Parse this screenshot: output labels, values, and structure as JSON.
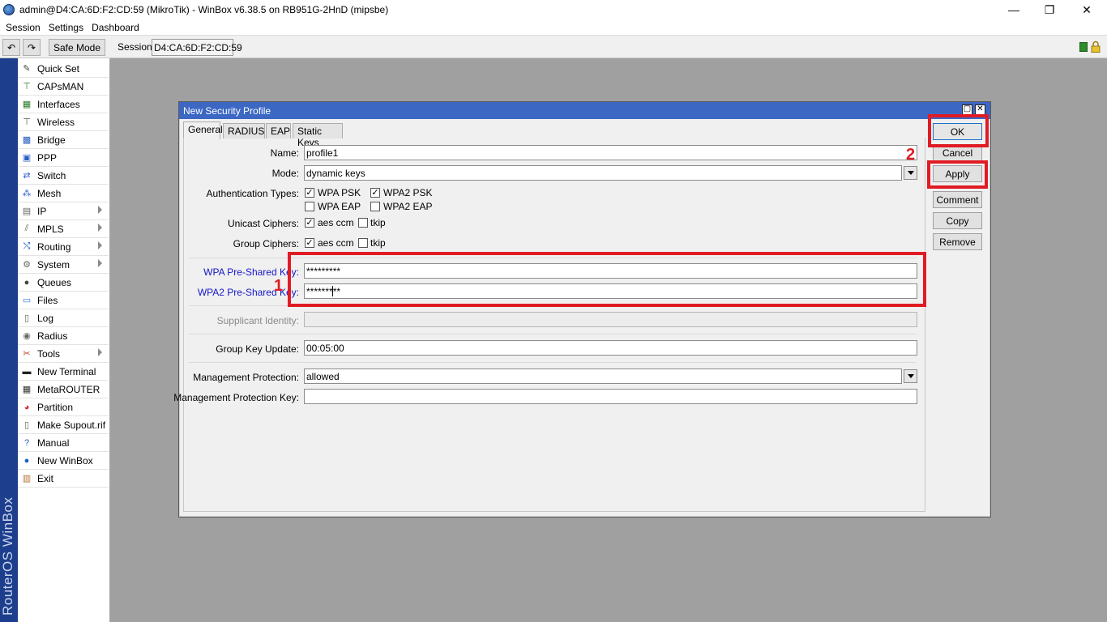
{
  "window": {
    "title": "admin@D4:CA:6D:F2:CD:59 (MikroTik) - WinBox v6.38.5 on RB951G-2HnD (mipsbe)",
    "minimize": "—",
    "restore": "❐",
    "close": "✕"
  },
  "menu": [
    "Session",
    "Settings",
    "Dashboard"
  ],
  "toolbar": {
    "undo_icon": "↶",
    "redo_icon": "↷",
    "safe_mode": "Safe Mode",
    "session_label": "Session:",
    "session_value": "D4:CA:6D:F2:CD:59"
  },
  "brand": "RouterOS WinBox",
  "sidebar": {
    "items": [
      {
        "label": "Quick Set",
        "icon": "quick-set-icon",
        "glyph": "✎",
        "color": "#444",
        "arrow": false
      },
      {
        "label": "CAPsMAN",
        "icon": "capsman-icon",
        "glyph": "⊤",
        "color": "#2a7a2a",
        "arrow": false
      },
      {
        "label": "Interfaces",
        "icon": "interfaces-icon",
        "glyph": "▦",
        "color": "#2a7a2a",
        "arrow": false
      },
      {
        "label": "Wireless",
        "icon": "wireless-icon",
        "glyph": "⊤",
        "color": "#555",
        "arrow": false
      },
      {
        "label": "Bridge",
        "icon": "bridge-icon",
        "glyph": "▩",
        "color": "#2a5fc4",
        "arrow": false
      },
      {
        "label": "PPP",
        "icon": "ppp-icon",
        "glyph": "▣",
        "color": "#2a5fc4",
        "arrow": false
      },
      {
        "label": "Switch",
        "icon": "switch-icon",
        "glyph": "⇄",
        "color": "#2a5fc4",
        "arrow": false
      },
      {
        "label": "Mesh",
        "icon": "mesh-icon",
        "glyph": "⁂",
        "color": "#2a5fc4",
        "arrow": false
      },
      {
        "label": "IP",
        "icon": "ip-icon",
        "glyph": "▤",
        "color": "#666",
        "arrow": true
      },
      {
        "label": "MPLS",
        "icon": "mpls-icon",
        "glyph": "⫽",
        "color": "#666",
        "arrow": true
      },
      {
        "label": "Routing",
        "icon": "routing-icon",
        "glyph": "⤭",
        "color": "#2a5fc4",
        "arrow": true
      },
      {
        "label": "System",
        "icon": "system-gear-icon",
        "glyph": "⚙",
        "color": "#666",
        "arrow": true
      },
      {
        "label": "Queues",
        "icon": "queues-icon",
        "glyph": "●",
        "color": "#444",
        "arrow": false
      },
      {
        "label": "Files",
        "icon": "files-icon",
        "glyph": "▭",
        "color": "#3a7bd5",
        "arrow": false
      },
      {
        "label": "Log",
        "icon": "log-icon",
        "glyph": "▯",
        "color": "#666",
        "arrow": false
      },
      {
        "label": "Radius",
        "icon": "radius-icon",
        "glyph": "◉",
        "color": "#666",
        "arrow": false
      },
      {
        "label": "Tools",
        "icon": "tools-icon",
        "glyph": "✂",
        "color": "#c04020",
        "arrow": true
      },
      {
        "label": "New Terminal",
        "icon": "terminal-icon",
        "glyph": "▬",
        "color": "#222",
        "arrow": false
      },
      {
        "label": "MetaROUTER",
        "icon": "metarouter-icon",
        "glyph": "▦",
        "color": "#333",
        "arrow": false
      },
      {
        "label": "Partition",
        "icon": "partition-icon",
        "glyph": "◕",
        "color": "#d03030",
        "arrow": false
      },
      {
        "label": "Make Supout.rif",
        "icon": "supout-icon",
        "glyph": "▯",
        "color": "#666",
        "arrow": false
      },
      {
        "label": "Manual",
        "icon": "manual-help-icon",
        "glyph": "?",
        "color": "#2a5fc4",
        "arrow": false
      },
      {
        "label": "New WinBox",
        "icon": "winbox-icon",
        "glyph": "●",
        "color": "#1d5fc4",
        "arrow": false
      },
      {
        "label": "Exit",
        "icon": "exit-icon",
        "glyph": "▥",
        "color": "#b0702a",
        "arrow": false
      }
    ]
  },
  "dialog": {
    "title": "New Security Profile",
    "tabs": [
      "General",
      "RADIUS",
      "EAP",
      "Static Keys"
    ],
    "active_tab": "General",
    "fields": {
      "name_label": "Name:",
      "name_value": "profile1",
      "mode_label": "Mode:",
      "mode_value": "dynamic keys",
      "auth_label": "Authentication Types:",
      "auth_options": [
        {
          "label": "WPA PSK",
          "checked": true
        },
        {
          "label": "WPA2 PSK",
          "checked": true
        },
        {
          "label": "WPA EAP",
          "checked": false
        },
        {
          "label": "WPA2 EAP",
          "checked": false
        }
      ],
      "unicast_label": "Unicast Ciphers:",
      "unicast_options": [
        {
          "label": "aes ccm",
          "checked": true
        },
        {
          "label": "tkip",
          "checked": false
        }
      ],
      "group_label": "Group Ciphers:",
      "group_options": [
        {
          "label": "aes ccm",
          "checked": true
        },
        {
          "label": "tkip",
          "checked": false
        }
      ],
      "wpa_psk_label": "WPA Pre-Shared Key:",
      "wpa_psk_value": "*********",
      "wpa2_psk_label": "WPA2 Pre-Shared Key:",
      "wpa2_psk_value": "*********",
      "supplicant_label": "Supplicant Identity:",
      "supplicant_value": "",
      "gku_label": "Group Key Update:",
      "gku_value": "00:05:00",
      "mgmt_prot_label": "Management Protection:",
      "mgmt_prot_value": "allowed",
      "mgmt_key_label": "Management Protection Key:",
      "mgmt_key_value": ""
    },
    "buttons": [
      "OK",
      "Cancel",
      "Apply",
      "Comment",
      "Copy",
      "Remove"
    ]
  },
  "annotations": {
    "marker_1": "1",
    "marker_2": "2"
  },
  "colors": {
    "dialog_title_bg": "#3c68c4",
    "annotation_red": "#e01b24",
    "brand_strip": "#1d3e8c",
    "workspace": "#a0a0a0"
  }
}
